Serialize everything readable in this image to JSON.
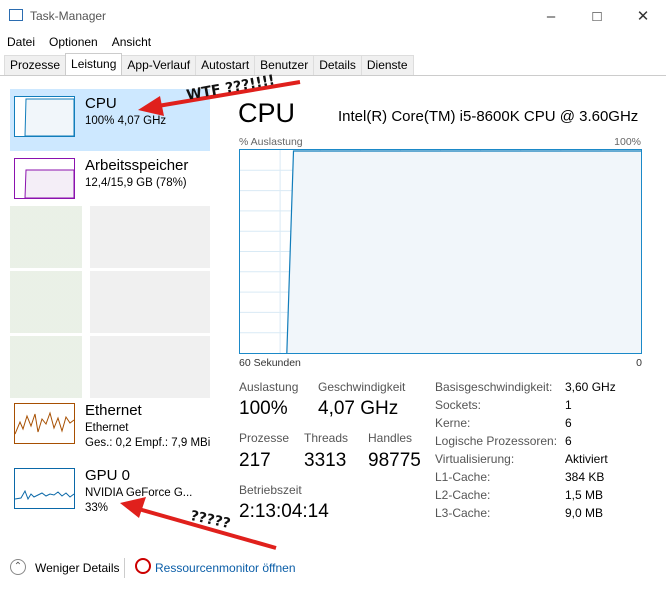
{
  "window": {
    "title": "Task-Manager"
  },
  "menu": [
    "Datei",
    "Optionen",
    "Ansicht"
  ],
  "tabs": [
    "Prozesse",
    "Leistung",
    "App-Verlauf",
    "Autostart",
    "Benutzer",
    "Details",
    "Dienste"
  ],
  "sidebar": {
    "cpu": {
      "name": "CPU",
      "sub": "100% 4,07 GHz",
      "usage_percent": 100
    },
    "memory": {
      "name": "Arbeitsspeicher",
      "sub": "12,4/15,9 GB (78%)",
      "usage_percent": 78
    },
    "ethernet": {
      "name": "Ethernet",
      "sub": "Ethernet",
      "sub2": "Ges.: 0,2 Empf.: 7,9 MBi"
    },
    "gpu": {
      "name": "GPU 0",
      "sub": "NVIDIA GeForce G...",
      "sub2": "33%"
    }
  },
  "panel": {
    "title": "CPU",
    "model": "Intel(R) Core(TM) i5-8600K CPU @ 3.60GHz",
    "graph_label_left": "% Auslastung",
    "graph_label_right": "100%",
    "time_left": "60 Sekunden",
    "time_right": "0"
  },
  "chart_data": {
    "type": "area",
    "x": [
      60,
      53,
      52,
      0
    ],
    "values": [
      0,
      0,
      100,
      100
    ],
    "ylim": [
      0,
      100
    ]
  },
  "stats": {
    "auslastung_label": "Auslastung",
    "auslastung": "100%",
    "geschwindigkeit_label": "Geschwindigkeit",
    "geschwindigkeit": "4,07 GHz",
    "prozesse_label": "Prozesse",
    "prozesse": "217",
    "threads_label": "Threads",
    "threads": "3313",
    "handles_label": "Handles",
    "handles": "98775",
    "betriebszeit_label": "Betriebszeit",
    "betriebszeit": "2:13:04:14"
  },
  "info": [
    {
      "label": "Basisgeschwindigkeit:",
      "value": "3,60 GHz"
    },
    {
      "label": "Sockets:",
      "value": "1"
    },
    {
      "label": "Kerne:",
      "value": "6"
    },
    {
      "label": "Logische Prozessoren:",
      "value": "6"
    },
    {
      "label": "Virtualisierung:",
      "value": "Aktiviert"
    },
    {
      "label": "L1-Cache:",
      "value": "384 KB"
    },
    {
      "label": "L2-Cache:",
      "value": "1,5 MB"
    },
    {
      "label": "L3-Cache:",
      "value": "9,0 MB"
    }
  ],
  "footer": {
    "less": "Weniger Details",
    "resmon": "Ressourcenmonitor öffnen"
  },
  "annotations": {
    "top": "WTF ???!!!!",
    "bottom": "?????"
  },
  "colors": {
    "cpu": "#117dbb",
    "memory": "#8b12ae",
    "ethernet": "#a74f01",
    "gpu": "#0a68a8",
    "arrow": "#e0201c",
    "selection": "#cde8ff"
  }
}
